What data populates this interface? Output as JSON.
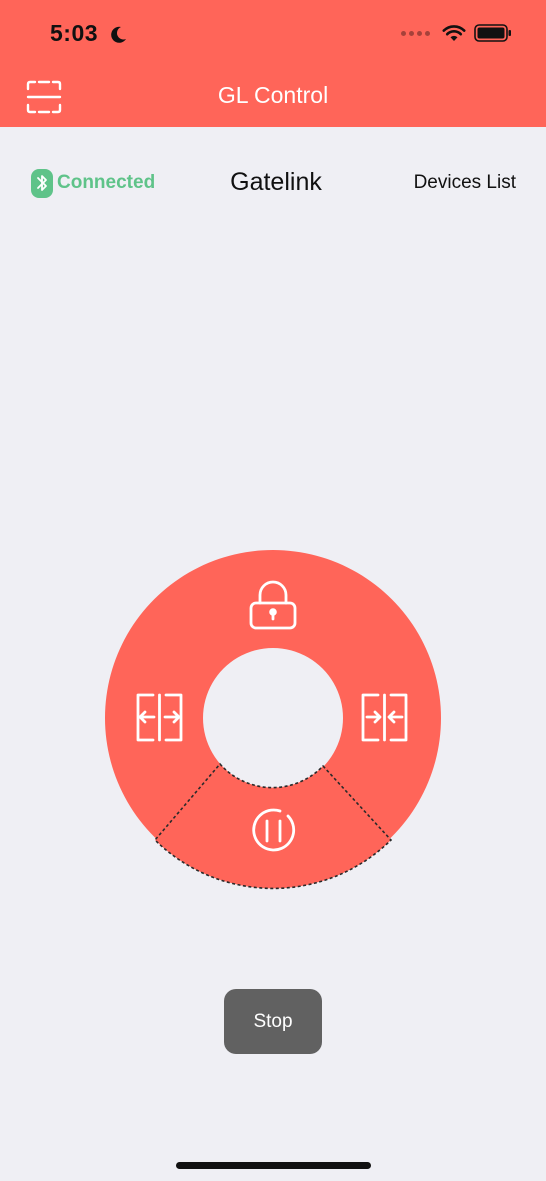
{
  "status_bar": {
    "time": "5:03"
  },
  "nav": {
    "title": "GL Control"
  },
  "connection": {
    "status": "Connected",
    "device_name": "Gatelink",
    "devices_list_label": "Devices List"
  },
  "controls": {
    "stop_label": "Stop"
  },
  "colors": {
    "accent": "#ff6559",
    "connected": "#5fc389",
    "stop_button": "#616161",
    "background": "#efeff4"
  },
  "icons": [
    "scan-icon",
    "bluetooth-icon",
    "lock-icon",
    "open-gate-icon",
    "close-gate-icon",
    "pause-icon",
    "moon-icon",
    "wifi-icon",
    "battery-icon"
  ]
}
